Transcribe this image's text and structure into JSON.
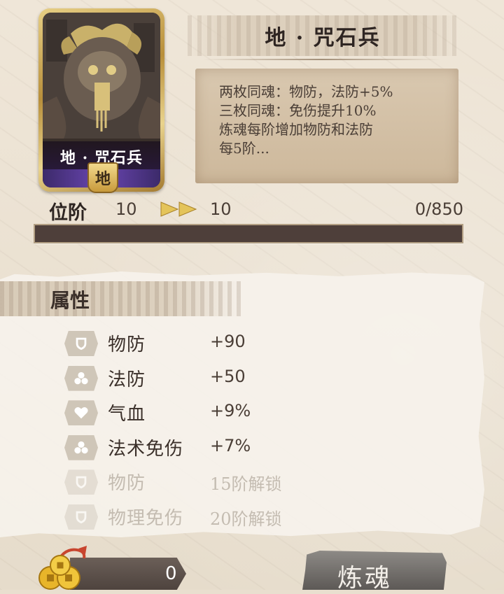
{
  "card": {
    "name": "地 · 咒石兵",
    "badge": "地"
  },
  "title": "地 · 咒石兵",
  "description": {
    "lines": [
      "两枚同魂：物防，法防+5%",
      "三枚同魂：免伤提升10%",
      "炼魂每阶增加物防和法防",
      "每5阶..."
    ]
  },
  "rank": {
    "label": "位阶",
    "current": "10",
    "next": "10",
    "exp": "0/850",
    "progress_fraction": 0
  },
  "attributes": {
    "title": "属性",
    "items": [
      {
        "name": "物防",
        "value": "+90",
        "icon": "shield-icon",
        "locked": false
      },
      {
        "name": "法防",
        "value": "+50",
        "icon": "clover-icon",
        "locked": false
      },
      {
        "name": "气血",
        "value": "+9%",
        "icon": "heart-icon",
        "locked": false
      },
      {
        "name": "法术免伤",
        "value": "+7%",
        "icon": "clover-icon",
        "locked": false
      },
      {
        "name": "物防",
        "value": "15阶解锁",
        "icon": "shield-icon",
        "locked": true
      },
      {
        "name": "物理免伤",
        "value": "20阶解锁",
        "icon": "shield-icon",
        "locked": true
      }
    ]
  },
  "currency": {
    "count": "0",
    "icon": "coin-icon"
  },
  "actions": {
    "refine_label": "炼魂"
  },
  "colors": {
    "progress_bar": "#4e3f3a",
    "card_gold": "#d4b466",
    "card_purple": "#5a3c9a"
  }
}
